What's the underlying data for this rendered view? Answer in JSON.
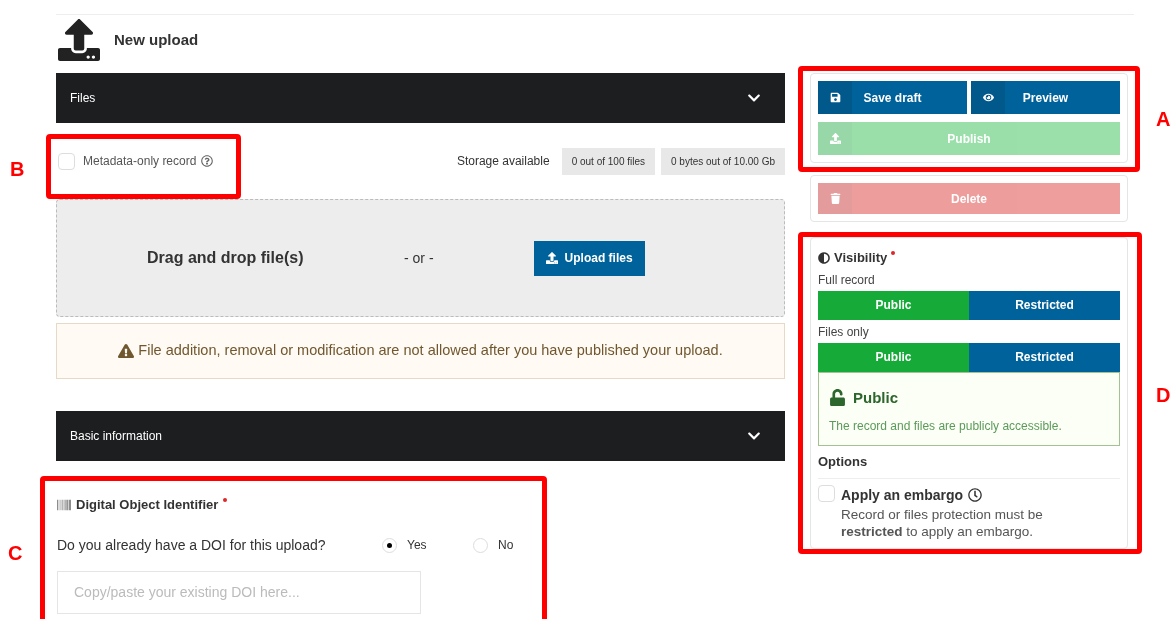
{
  "header": {
    "title": "New upload"
  },
  "files_section": {
    "title": "Files",
    "expanded": true,
    "metadata_only": {
      "label": "Metadata-only record",
      "checked": false
    },
    "storage": {
      "label": "Storage available",
      "files": "0 out of 100 files",
      "bytes": "0 bytes out of 10.00 Gb"
    },
    "dropzone": {
      "text": "Drag and drop file(s)",
      "separator": "- or -",
      "button": "Upload files"
    },
    "warning": "File addition, removal or modification are not allowed after you have published your upload."
  },
  "basic_section": {
    "title": "Basic information",
    "expanded": true,
    "doi": {
      "title": "Digital Object Identifier",
      "required": true,
      "question": "Do you already have a DOI for this upload?",
      "options": [
        {
          "label": "Yes",
          "selected": true
        },
        {
          "label": "No",
          "selected": false
        }
      ],
      "placeholder": "Copy/paste your existing DOI here..."
    }
  },
  "actions": [
    {
      "kind": "save",
      "label": "Save draft",
      "disabled": false
    },
    {
      "kind": "preview",
      "label": "Preview",
      "disabled": false
    },
    {
      "kind": "publish",
      "label": "Publish",
      "disabled": true
    }
  ],
  "delete": {
    "label": "Delete",
    "disabled": true
  },
  "visibility": {
    "title": "Visibility",
    "required": true,
    "groups": [
      {
        "label": "Full record",
        "options": [
          {
            "label": "Public",
            "selected": true
          },
          {
            "label": "Restricted",
            "selected": false
          }
        ]
      },
      {
        "label": "Files only",
        "options": [
          {
            "label": "Public",
            "selected": true
          },
          {
            "label": "Restricted",
            "selected": false
          }
        ]
      }
    ],
    "notice": {
      "title": "Public",
      "text": "The record and files are publicly accessible."
    },
    "options_title": "Options",
    "embargo": {
      "label": "Apply an embargo",
      "checked": false,
      "text": "Record or files protection must be **restricted** to apply an embargo."
    }
  },
  "annotations": [
    {
      "letter": "A"
    },
    {
      "letter": "B"
    },
    {
      "letter": "C"
    },
    {
      "letter": "D"
    }
  ]
}
